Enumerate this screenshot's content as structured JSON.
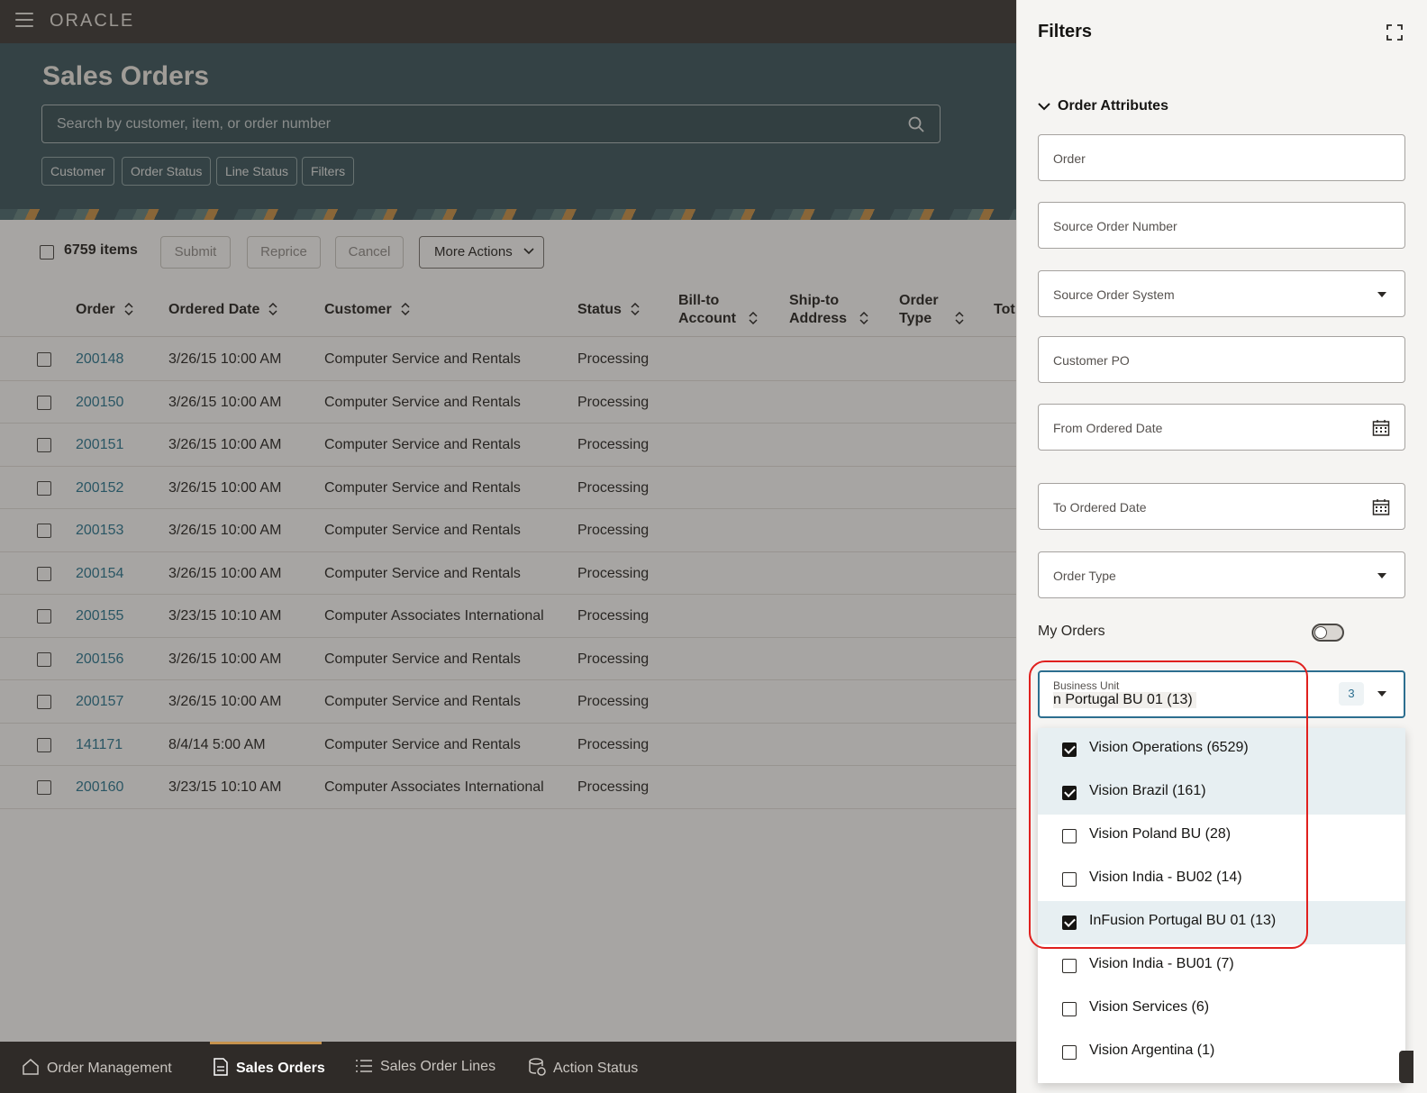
{
  "app": {
    "brand": "ORACLE",
    "page_title": "Sales Orders"
  },
  "search": {
    "placeholder": "Search by customer, item, or order number"
  },
  "chips": [
    "Customer",
    "Order Status",
    "Line Status",
    "Filters"
  ],
  "toolbar": {
    "items_count": "6759 items",
    "submit": "Submit",
    "reprice": "Reprice",
    "cancel": "Cancel",
    "more_actions": "More Actions"
  },
  "table": {
    "headers": {
      "order": "Order",
      "ordered_date": "Ordered Date",
      "customer": "Customer",
      "status": "Status",
      "bill_to_1": "Bill-to",
      "bill_to_2": "Account",
      "ship_to_1": "Ship-to",
      "ship_to_2": "Address",
      "order_type_1": "Order",
      "order_type_2": "Type",
      "total": "Tot"
    },
    "rows": [
      {
        "order": "200148",
        "date": "3/26/15 10:00 AM",
        "customer": "Computer Service and Rentals",
        "status": "Processing"
      },
      {
        "order": "200150",
        "date": "3/26/15 10:00 AM",
        "customer": "Computer Service and Rentals",
        "status": "Processing"
      },
      {
        "order": "200151",
        "date": "3/26/15 10:00 AM",
        "customer": "Computer Service and Rentals",
        "status": "Processing"
      },
      {
        "order": "200152",
        "date": "3/26/15 10:00 AM",
        "customer": "Computer Service and Rentals",
        "status": "Processing"
      },
      {
        "order": "200153",
        "date": "3/26/15 10:00 AM",
        "customer": "Computer Service and Rentals",
        "status": "Processing"
      },
      {
        "order": "200154",
        "date": "3/26/15 10:00 AM",
        "customer": "Computer Service and Rentals",
        "status": "Processing"
      },
      {
        "order": "200155",
        "date": "3/23/15 10:10 AM",
        "customer": "Computer Associates International",
        "status": "Processing"
      },
      {
        "order": "200156",
        "date": "3/26/15 10:00 AM",
        "customer": "Computer Service and Rentals",
        "status": "Processing"
      },
      {
        "order": "200157",
        "date": "3/26/15 10:00 AM",
        "customer": "Computer Service and Rentals",
        "status": "Processing"
      },
      {
        "order": "141171",
        "date": "8/4/14 5:00 AM",
        "customer": "Computer Service and Rentals",
        "status": "Processing"
      },
      {
        "order": "200160",
        "date": "3/23/15 10:10 AM",
        "customer": "Computer Associates International",
        "status": "Processing"
      }
    ]
  },
  "bottom_nav": {
    "order_management": "Order Management",
    "sales_orders": "Sales Orders",
    "sales_order_lines": "Sales Order Lines",
    "action_status": "Action Status"
  },
  "filters": {
    "title": "Filters",
    "section": "Order Attributes",
    "fields": {
      "order": "Order",
      "source_order_number": "Source Order Number",
      "source_order_system": "Source Order System",
      "customer_po": "Customer PO",
      "from_ordered_date": "From Ordered Date",
      "to_ordered_date": "To Ordered Date",
      "order_type": "Order Type"
    },
    "my_orders": "My Orders",
    "business_unit": {
      "label": "Business Unit",
      "value": "n Portugal BU 01 (13)",
      "selected_count": "3",
      "options": [
        {
          "label": "Vision Operations (6529)",
          "checked": true
        },
        {
          "label": "Vision Brazil (161)",
          "checked": true
        },
        {
          "label": "Vision Poland BU (28)",
          "checked": false
        },
        {
          "label": "Vision India - BU02 (14)",
          "checked": false
        },
        {
          "label": "InFusion Portugal BU 01 (13)",
          "checked": true
        },
        {
          "label": "Vision India - BU01 (7)",
          "checked": false
        },
        {
          "label": "Vision Services (6)",
          "checked": false
        },
        {
          "label": "Vision Argentina (1)",
          "checked": false
        }
      ]
    }
  },
  "colors": {
    "brand_bar": "#312d2a",
    "hero": "#2f4c55",
    "link": "#1d6f8c",
    "focus": "#2c6e8f",
    "highlight": "#e0201e"
  }
}
